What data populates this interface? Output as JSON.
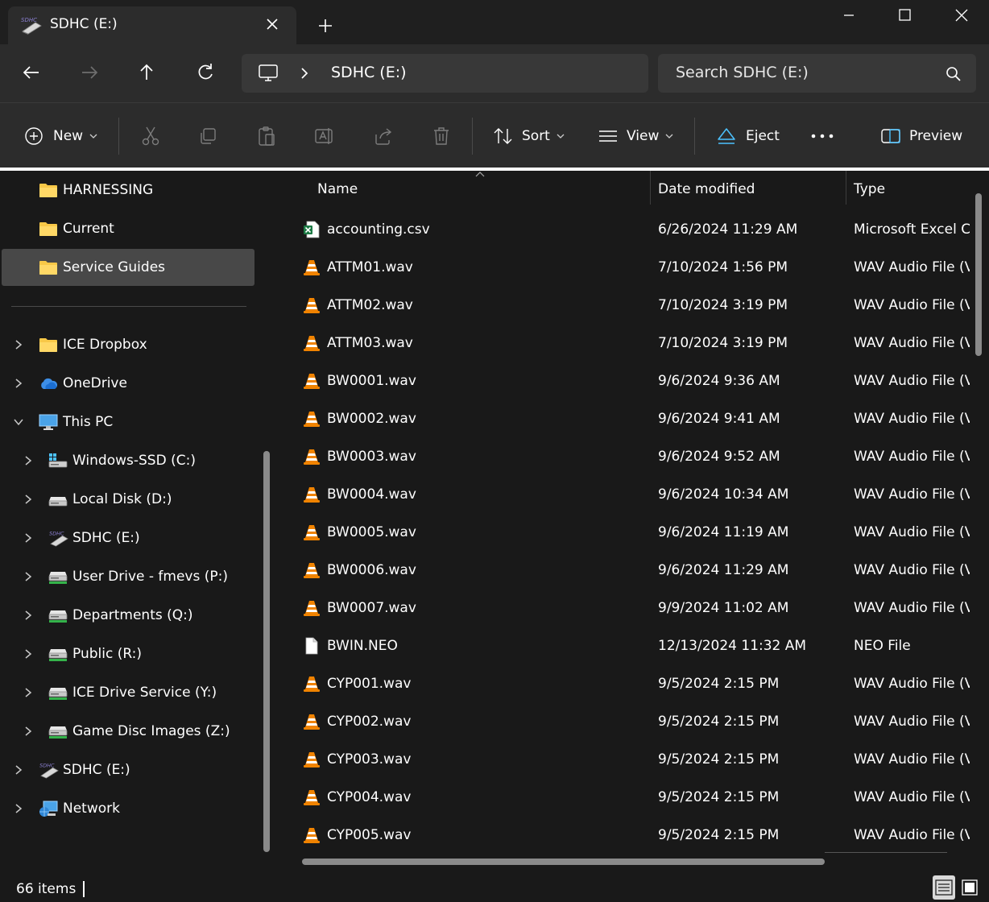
{
  "window": {
    "tab_title": "SDHC (E:)",
    "tab_icon": "sd-card-icon",
    "close_tab_icon": "close-icon",
    "new_tab_icon": "plus-icon"
  },
  "address": {
    "path_root_icon": "computer-icon",
    "path": "SDHC (E:)",
    "search_placeholder": "Search SDHC (E:)"
  },
  "toolbar": {
    "new_label": "New",
    "sort_label": "Sort",
    "view_label": "View",
    "eject_label": "Eject",
    "preview_label": "Preview"
  },
  "sidebar": {
    "items": [
      {
        "label": "HARNESSING",
        "icon": "folder-icon"
      },
      {
        "label": "Current",
        "icon": "folder-icon"
      },
      {
        "label": "Service Guides",
        "icon": "folder-icon",
        "selected": true
      },
      {
        "label": "ICE Dropbox",
        "icon": "folder-icon"
      },
      {
        "label": "OneDrive",
        "icon": "cloud-icon"
      },
      {
        "label": "This PC",
        "icon": "computer-icon",
        "expanded": true
      },
      {
        "label": "Windows-SSD (C:)",
        "icon": "windows-drive-icon"
      },
      {
        "label": "Local Disk (D:)",
        "icon": "drive-icon"
      },
      {
        "label": "SDHC (E:)",
        "icon": "sd-card-icon"
      },
      {
        "label": "User Drive - fmevs (P:)",
        "icon": "network-drive-icon"
      },
      {
        "label": "Departments (Q:)",
        "icon": "network-drive-icon"
      },
      {
        "label": "Public (R:)",
        "icon": "network-drive-icon"
      },
      {
        "label": "ICE Drive Service (Y:)",
        "icon": "network-drive-icon"
      },
      {
        "label": "Game Disc Images (Z:)",
        "icon": "network-drive-icon"
      },
      {
        "label": "SDHC (E:)",
        "icon": "sd-card-icon"
      },
      {
        "label": "Network",
        "icon": "network-icon"
      }
    ]
  },
  "columns": {
    "name": "Name",
    "date": "Date modified",
    "type": "Type"
  },
  "files": [
    {
      "name": "accounting.csv",
      "date": "6/26/2024 11:29 AM",
      "type": "Microsoft Excel Co",
      "icon": "excel-icon"
    },
    {
      "name": "ATTM01.wav",
      "date": "7/10/2024 1:56 PM",
      "type": "WAV Audio File (V",
      "icon": "vlc-icon"
    },
    {
      "name": "ATTM02.wav",
      "date": "7/10/2024 3:19 PM",
      "type": "WAV Audio File (V",
      "icon": "vlc-icon"
    },
    {
      "name": "ATTM03.wav",
      "date": "7/10/2024 3:19 PM",
      "type": "WAV Audio File (V",
      "icon": "vlc-icon"
    },
    {
      "name": "BW0001.wav",
      "date": "9/6/2024 9:36 AM",
      "type": "WAV Audio File (V",
      "icon": "vlc-icon"
    },
    {
      "name": "BW0002.wav",
      "date": "9/6/2024 9:41 AM",
      "type": "WAV Audio File (V",
      "icon": "vlc-icon"
    },
    {
      "name": "BW0003.wav",
      "date": "9/6/2024 9:52 AM",
      "type": "WAV Audio File (V",
      "icon": "vlc-icon"
    },
    {
      "name": "BW0004.wav",
      "date": "9/6/2024 10:34 AM",
      "type": "WAV Audio File (V",
      "icon": "vlc-icon"
    },
    {
      "name": "BW0005.wav",
      "date": "9/6/2024 11:19 AM",
      "type": "WAV Audio File (V",
      "icon": "vlc-icon"
    },
    {
      "name": "BW0006.wav",
      "date": "9/6/2024 11:29 AM",
      "type": "WAV Audio File (V",
      "icon": "vlc-icon"
    },
    {
      "name": "BW0007.wav",
      "date": "9/9/2024 11:02 AM",
      "type": "WAV Audio File (V",
      "icon": "vlc-icon"
    },
    {
      "name": "BWIN.NEO",
      "date": "12/13/2024 11:32 AM",
      "type": "NEO File",
      "icon": "file-icon"
    },
    {
      "name": "CYP001.wav",
      "date": "9/5/2024 2:15 PM",
      "type": "WAV Audio File (V",
      "icon": "vlc-icon"
    },
    {
      "name": "CYP002.wav",
      "date": "9/5/2024 2:15 PM",
      "type": "WAV Audio File (V",
      "icon": "vlc-icon"
    },
    {
      "name": "CYP003.wav",
      "date": "9/5/2024 2:15 PM",
      "type": "WAV Audio File (V",
      "icon": "vlc-icon"
    },
    {
      "name": "CYP004.wav",
      "date": "9/5/2024 2:15 PM",
      "type": "WAV Audio File (V",
      "icon": "vlc-icon"
    },
    {
      "name": "CYP005.wav",
      "date": "9/5/2024 2:15 PM",
      "type": "WAV Audio File (V",
      "icon": "vlc-icon"
    }
  ],
  "status": {
    "item_count": "66 items"
  },
  "colors": {
    "background": "#191919",
    "chrome": "#2c2c2c",
    "selected": "#484848",
    "folder": "#f8c847",
    "vlc_orange": "#f08300",
    "accent_blue": "#4cc2ff"
  }
}
